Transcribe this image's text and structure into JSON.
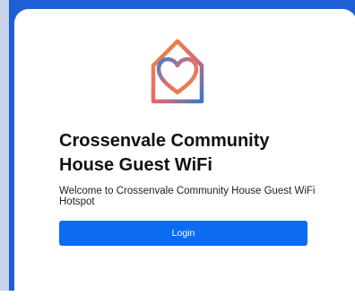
{
  "portal": {
    "title": "Crossenvale Community House Guest WiFi",
    "welcome": "Welcome to Crossenvale Community House Guest WiFi Hotspot",
    "login_label": "Login",
    "logo_icon": "house-heart-icon"
  },
  "colors": {
    "background_blue": "#1f5fd6",
    "button_blue": "#0b6cf3",
    "logo_orange": "#ee7f3a",
    "logo_blue": "#3f7fc9"
  }
}
